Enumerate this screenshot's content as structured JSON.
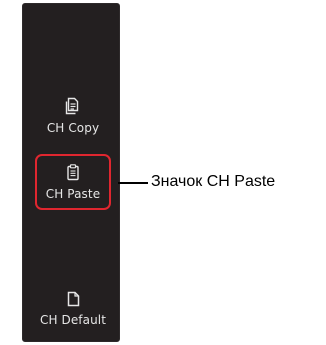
{
  "panel": {
    "buttons": [
      {
        "label": "CH Copy",
        "icon": "copy-icon"
      },
      {
        "label": "CH Paste",
        "icon": "paste-icon",
        "highlighted": true,
        "highlight_color": "#e0262f"
      },
      {
        "label": "CH Default",
        "icon": "document-icon"
      }
    ]
  },
  "callout": {
    "text": "Значок CH Paste"
  },
  "colors": {
    "panel_bg": "#231f20",
    "label_text": "#e6e6e6",
    "highlight": "#e0262f"
  }
}
